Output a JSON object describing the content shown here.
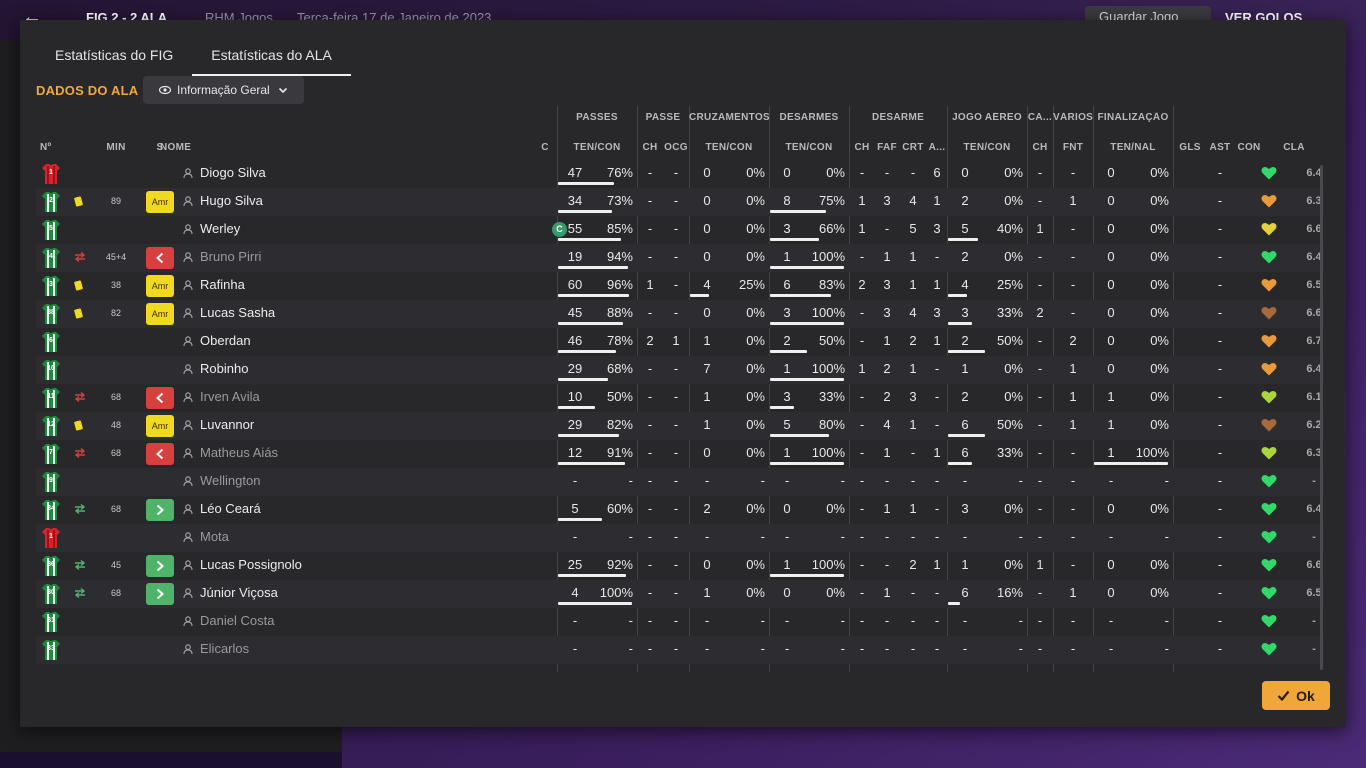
{
  "background": {
    "score": "FIG  2 - 2  ALA",
    "team": "RHM Jogos",
    "date": "Terça-feira 17 de Janeiro de 2023",
    "save_label": "Guardar Jogo",
    "goals_label": "VER GOLOS"
  },
  "tabs": [
    {
      "label": "Estatísticas do FIG",
      "active": false
    },
    {
      "label": "Estatísticas do ALA",
      "active": true
    }
  ],
  "section_title": "DADOS DO ALA",
  "view_select": {
    "value": "Informação Geral"
  },
  "groups": {
    "passes": "PASSES",
    "passe": "PASSE",
    "cruzamentos": "CRUZAMENTOS",
    "desarmes": "DESARMES",
    "desarme": "DESARME",
    "jogo_aereo": "JOGO AÉREO",
    "ca": "CA...",
    "varios": "VÁRIOS",
    "finalizacao": "FINALIZAÇÃO"
  },
  "headers": {
    "num": "Nº",
    "min": "MIN",
    "s": "S",
    "nome": "NOME",
    "c": "C",
    "passes": "TEN/CON",
    "ch1": "CH",
    "ocg": "OCG",
    "cruz": "TEN/CON",
    "des": "TEN/CON",
    "ch2": "CH",
    "faf": "FAF",
    "crt": "CRT",
    "a": "A...",
    "aereo": "TEN/CON",
    "ch3": "CH",
    "fnt": "FNT",
    "fin": "TEN/NAL",
    "gls": "GLS",
    "ast": "AST",
    "con": "CON",
    "cla": "CLA"
  },
  "players": [
    {
      "num": "1",
      "kit": "red",
      "card": "",
      "swap": "",
      "min": "",
      "status": "",
      "name": "Diogo Silva",
      "captain": "",
      "p_att": "47",
      "p_pct": "76%",
      "p_frac": 0.76,
      "ch1": "-",
      "ocg": "-",
      "cr_att": "0",
      "cr_pct": "0%",
      "cr_frac": 0,
      "d_att": "0",
      "d_pct": "0%",
      "d_frac": 0,
      "ch2": "-",
      "faf": "-",
      "crt": "-",
      "a": "6",
      "ae_att": "0",
      "ae_pct": "0%",
      "ae_frac": 0,
      "ch3": "-",
      "fnt": "-",
      "f_att": "0",
      "f_pct": "0%",
      "f_frac": 0,
      "gls": "",
      "ast": "-",
      "heart": "green",
      "rating": "6.4",
      "subbed": false
    },
    {
      "num": "2",
      "kit": "green",
      "card": "yellow",
      "swap": "",
      "min": "89",
      "status": "Amr",
      "name": "Hugo Silva",
      "captain": "",
      "p_att": "34",
      "p_pct": "73%",
      "p_frac": 0.73,
      "ch1": "-",
      "ocg": "-",
      "cr_att": "0",
      "cr_pct": "0%",
      "cr_frac": 0,
      "d_att": "8",
      "d_pct": "75%",
      "d_frac": 0.75,
      "ch2": "1",
      "faf": "3",
      "crt": "4",
      "a": "1",
      "ae_att": "2",
      "ae_pct": "0%",
      "ae_frac": 0,
      "ch3": "-",
      "fnt": "1",
      "f_att": "0",
      "f_pct": "0%",
      "f_frac": 0,
      "gls": "",
      "ast": "-",
      "heart": "orange",
      "rating": "6.3",
      "subbed": false
    },
    {
      "num": "5",
      "kit": "green",
      "card": "",
      "swap": "",
      "min": "",
      "status": "",
      "name": "Werley",
      "captain": "C",
      "p_att": "55",
      "p_pct": "85%",
      "p_frac": 0.85,
      "ch1": "-",
      "ocg": "-",
      "cr_att": "0",
      "cr_pct": "0%",
      "cr_frac": 0,
      "d_att": "3",
      "d_pct": "66%",
      "d_frac": 0.66,
      "ch2": "1",
      "faf": "-",
      "crt": "5",
      "a": "3",
      "ae_att": "5",
      "ae_pct": "40%",
      "ae_frac": 0.4,
      "ch3": "1",
      "fnt": "-",
      "f_att": "0",
      "f_pct": "0%",
      "f_frac": 0,
      "gls": "",
      "ast": "-",
      "heart": "yellow",
      "rating": "6.6",
      "subbed": false
    },
    {
      "num": "4",
      "kit": "green",
      "card": "",
      "swap": "red",
      "min": "45+4",
      "status": "out",
      "name": "Bruno Pirri",
      "captain": "",
      "p_att": "19",
      "p_pct": "94%",
      "p_frac": 0.94,
      "ch1": "-",
      "ocg": "-",
      "cr_att": "0",
      "cr_pct": "0%",
      "cr_frac": 0,
      "d_att": "1",
      "d_pct": "100%",
      "d_frac": 1,
      "ch2": "-",
      "faf": "1",
      "crt": "1",
      "a": "-",
      "ae_att": "2",
      "ae_pct": "0%",
      "ae_frac": 0,
      "ch3": "-",
      "fnt": "-",
      "f_att": "0",
      "f_pct": "0%",
      "f_frac": 0,
      "gls": "",
      "ast": "-",
      "heart": "green",
      "rating": "6.4",
      "subbed": true
    },
    {
      "num": "3",
      "kit": "green",
      "card": "yellow",
      "swap": "",
      "min": "38",
      "status": "Amr",
      "name": "Rafinha",
      "captain": "",
      "p_att": "60",
      "p_pct": "96%",
      "p_frac": 0.96,
      "ch1": "1",
      "ocg": "-",
      "cr_att": "4",
      "cr_pct": "25%",
      "cr_frac": 0.25,
      "d_att": "6",
      "d_pct": "83%",
      "d_frac": 0.83,
      "ch2": "2",
      "faf": "3",
      "crt": "1",
      "a": "1",
      "ae_att": "4",
      "ae_pct": "25%",
      "ae_frac": 0.25,
      "ch3": "-",
      "fnt": "-",
      "f_att": "0",
      "f_pct": "0%",
      "f_frac": 0,
      "gls": "",
      "ast": "-",
      "heart": "orange",
      "rating": "6.5",
      "subbed": false
    },
    {
      "num": "88",
      "kit": "green",
      "card": "yellow",
      "swap": "",
      "min": "82",
      "status": "Amr",
      "name": "Lucas Sasha",
      "captain": "",
      "p_att": "45",
      "p_pct": "88%",
      "p_frac": 0.88,
      "ch1": "-",
      "ocg": "-",
      "cr_att": "0",
      "cr_pct": "0%",
      "cr_frac": 0,
      "d_att": "3",
      "d_pct": "100%",
      "d_frac": 1,
      "ch2": "-",
      "faf": "3",
      "crt": "4",
      "a": "3",
      "ae_att": "3",
      "ae_pct": "33%",
      "ae_frac": 0.33,
      "ch3": "2",
      "fnt": "-",
      "f_att": "0",
      "f_pct": "0%",
      "f_frac": 0,
      "gls": "",
      "ast": "-",
      "heart": "brown",
      "rating": "6.6",
      "subbed": false
    },
    {
      "num": "6",
      "kit": "green",
      "card": "",
      "swap": "",
      "min": "",
      "status": "",
      "name": "Oberdan",
      "captain": "",
      "p_att": "46",
      "p_pct": "78%",
      "p_frac": 0.78,
      "ch1": "2",
      "ocg": "1",
      "cr_att": "1",
      "cr_pct": "0%",
      "cr_frac": 0,
      "d_att": "2",
      "d_pct": "50%",
      "d_frac": 0.5,
      "ch2": "-",
      "faf": "1",
      "crt": "2",
      "a": "1",
      "ae_att": "2",
      "ae_pct": "50%",
      "ae_frac": 0.5,
      "ch3": "-",
      "fnt": "2",
      "f_att": "0",
      "f_pct": "0%",
      "f_frac": 0,
      "gls": "",
      "ast": "-",
      "heart": "orange",
      "rating": "6.7",
      "subbed": false
    },
    {
      "num": "10",
      "kit": "green",
      "card": "",
      "swap": "",
      "min": "",
      "status": "",
      "name": "Robinho",
      "captain": "",
      "p_att": "29",
      "p_pct": "68%",
      "p_frac": 0.68,
      "ch1": "-",
      "ocg": "-",
      "cr_att": "7",
      "cr_pct": "0%",
      "cr_frac": 0,
      "d_att": "1",
      "d_pct": "100%",
      "d_frac": 1,
      "ch2": "1",
      "faf": "2",
      "crt": "1",
      "a": "-",
      "ae_att": "1",
      "ae_pct": "0%",
      "ae_frac": 0,
      "ch3": "-",
      "fnt": "1",
      "f_att": "0",
      "f_pct": "0%",
      "f_frac": 0,
      "gls": "",
      "ast": "-",
      "heart": "orange",
      "rating": "6.4",
      "subbed": false
    },
    {
      "num": "11",
      "kit": "green",
      "card": "",
      "swap": "red",
      "min": "68",
      "status": "out",
      "name": "Irven Avila",
      "captain": "",
      "p_att": "10",
      "p_pct": "50%",
      "p_frac": 0.5,
      "ch1": "-",
      "ocg": "-",
      "cr_att": "1",
      "cr_pct": "0%",
      "cr_frac": 0,
      "d_att": "3",
      "d_pct": "33%",
      "d_frac": 0.33,
      "ch2": "-",
      "faf": "2",
      "crt": "3",
      "a": "-",
      "ae_att": "2",
      "ae_pct": "0%",
      "ae_frac": 0,
      "ch3": "-",
      "fnt": "1",
      "f_att": "1",
      "f_pct": "0%",
      "f_frac": 0,
      "gls": "",
      "ast": "-",
      "heart": "lime",
      "rating": "6.1",
      "subbed": true
    },
    {
      "num": "12",
      "kit": "green",
      "card": "yellow",
      "swap": "",
      "min": "48",
      "status": "Amr",
      "name": "Luvannor",
      "captain": "",
      "p_att": "29",
      "p_pct": "82%",
      "p_frac": 0.82,
      "ch1": "-",
      "ocg": "-",
      "cr_att": "1",
      "cr_pct": "0%",
      "cr_frac": 0,
      "d_att": "5",
      "d_pct": "80%",
      "d_frac": 0.8,
      "ch2": "-",
      "faf": "4",
      "crt": "1",
      "a": "-",
      "ae_att": "6",
      "ae_pct": "50%",
      "ae_frac": 0.5,
      "ch3": "-",
      "fnt": "1",
      "f_att": "1",
      "f_pct": "0%",
      "f_frac": 0,
      "gls": "",
      "ast": "-",
      "heart": "brown",
      "rating": "6.2",
      "subbed": false
    },
    {
      "num": "7",
      "kit": "green",
      "card": "",
      "swap": "red",
      "min": "68",
      "status": "out",
      "name": "Matheus Aiás",
      "captain": "",
      "p_att": "12",
      "p_pct": "91%",
      "p_frac": 0.91,
      "ch1": "-",
      "ocg": "-",
      "cr_att": "0",
      "cr_pct": "0%",
      "cr_frac": 0,
      "d_att": "1",
      "d_pct": "100%",
      "d_frac": 1,
      "ch2": "-",
      "faf": "1",
      "crt": "-",
      "a": "1",
      "ae_att": "6",
      "ae_pct": "33%",
      "ae_frac": 0.33,
      "ch3": "-",
      "fnt": "-",
      "f_att": "1",
      "f_pct": "100%",
      "f_frac": 1,
      "gls": "",
      "ast": "-",
      "heart": "lime",
      "rating": "6.3",
      "subbed": true
    },
    {
      "num": "9",
      "kit": "green",
      "card": "",
      "swap": "",
      "min": "",
      "status": "",
      "name": "Wellington",
      "captain": "",
      "p_att": "-",
      "p_pct": "-",
      "p_frac": 0,
      "ch1": "-",
      "ocg": "-",
      "cr_att": "-",
      "cr_pct": "-",
      "cr_frac": 0,
      "d_att": "-",
      "d_pct": "-",
      "d_frac": 0,
      "ch2": "-",
      "faf": "-",
      "crt": "-",
      "a": "-",
      "ae_att": "-",
      "ae_pct": "-",
      "ae_frac": 0,
      "ch3": "-",
      "fnt": "-",
      "f_att": "-",
      "f_pct": "-",
      "f_frac": 0,
      "gls": "",
      "ast": "-",
      "heart": "green",
      "rating": "-",
      "subbed": true
    },
    {
      "num": "34",
      "kit": "green",
      "card": "",
      "swap": "green",
      "min": "68",
      "status": "in",
      "name": "Léo Ceará",
      "captain": "",
      "p_att": "5",
      "p_pct": "60%",
      "p_frac": 0.6,
      "ch1": "-",
      "ocg": "-",
      "cr_att": "2",
      "cr_pct": "0%",
      "cr_frac": 0,
      "d_att": "0",
      "d_pct": "0%",
      "d_frac": 0,
      "ch2": "-",
      "faf": "1",
      "crt": "1",
      "a": "-",
      "ae_att": "3",
      "ae_pct": "0%",
      "ae_frac": 0,
      "ch3": "-",
      "fnt": "-",
      "f_att": "0",
      "f_pct": "0%",
      "f_frac": 0,
      "gls": "",
      "ast": "-",
      "heart": "green",
      "rating": "6.4",
      "subbed": false
    },
    {
      "num": "1",
      "kit": "red",
      "card": "",
      "swap": "",
      "min": "",
      "status": "",
      "name": "Mota",
      "captain": "",
      "p_att": "-",
      "p_pct": "-",
      "p_frac": 0,
      "ch1": "-",
      "ocg": "-",
      "cr_att": "-",
      "cr_pct": "-",
      "cr_frac": 0,
      "d_att": "-",
      "d_pct": "-",
      "d_frac": 0,
      "ch2": "-",
      "faf": "-",
      "crt": "-",
      "a": "-",
      "ae_att": "-",
      "ae_pct": "-",
      "ae_frac": 0,
      "ch3": "-",
      "fnt": "-",
      "f_att": "-",
      "f_pct": "-",
      "f_frac": 0,
      "gls": "",
      "ast": "-",
      "heart": "green",
      "rating": "-",
      "subbed": true
    },
    {
      "num": "36",
      "kit": "green",
      "card": "",
      "swap": "green",
      "min": "45",
      "status": "in",
      "name": "Lucas Possignolo",
      "captain": "",
      "p_att": "25",
      "p_pct": "92%",
      "p_frac": 0.92,
      "ch1": "-",
      "ocg": "-",
      "cr_att": "0",
      "cr_pct": "0%",
      "cr_frac": 0,
      "d_att": "1",
      "d_pct": "100%",
      "d_frac": 1,
      "ch2": "-",
      "faf": "-",
      "crt": "2",
      "a": "1",
      "ae_att": "1",
      "ae_pct": "0%",
      "ae_frac": 0,
      "ch3": "1",
      "fnt": "-",
      "f_att": "0",
      "f_pct": "0%",
      "f_frac": 0,
      "gls": "",
      "ast": "-",
      "heart": "green",
      "rating": "6.6",
      "subbed": false
    },
    {
      "num": "30",
      "kit": "green",
      "card": "",
      "swap": "green",
      "min": "68",
      "status": "in",
      "name": "Júnior Viçosa",
      "captain": "",
      "p_att": "4",
      "p_pct": "100%",
      "p_frac": 1,
      "ch1": "-",
      "ocg": "-",
      "cr_att": "1",
      "cr_pct": "0%",
      "cr_frac": 0,
      "d_att": "0",
      "d_pct": "0%",
      "d_frac": 0,
      "ch2": "-",
      "faf": "1",
      "crt": "-",
      "a": "-",
      "ae_att": "6",
      "ae_pct": "16%",
      "ae_frac": 0.16,
      "ch3": "-",
      "fnt": "1",
      "f_att": "0",
      "f_pct": "0%",
      "f_frac": 0,
      "gls": "",
      "ast": "-",
      "heart": "green",
      "rating": "6.5",
      "subbed": false
    },
    {
      "num": "31",
      "kit": "green",
      "card": "",
      "swap": "",
      "min": "",
      "status": "",
      "name": "Daniel Costa",
      "captain": "",
      "p_att": "-",
      "p_pct": "-",
      "p_frac": 0,
      "ch1": "-",
      "ocg": "-",
      "cr_att": "-",
      "cr_pct": "-",
      "cr_frac": 0,
      "d_att": "-",
      "d_pct": "-",
      "d_frac": 0,
      "ch2": "-",
      "faf": "-",
      "crt": "-",
      "a": "-",
      "ae_att": "-",
      "ae_pct": "-",
      "ae_frac": 0,
      "ch3": "-",
      "fnt": "-",
      "f_att": "-",
      "f_pct": "-",
      "f_frac": 0,
      "gls": "",
      "ast": "-",
      "heart": "green",
      "rating": "-",
      "subbed": true
    },
    {
      "num": "33",
      "kit": "green",
      "card": "",
      "swap": "",
      "min": "",
      "status": "",
      "name": "Elicarlos",
      "captain": "",
      "p_att": "-",
      "p_pct": "-",
      "p_frac": 0,
      "ch1": "-",
      "ocg": "-",
      "cr_att": "-",
      "cr_pct": "-",
      "cr_frac": 0,
      "d_att": "-",
      "d_pct": "-",
      "d_frac": 0,
      "ch2": "-",
      "faf": "-",
      "crt": "-",
      "a": "-",
      "ae_att": "-",
      "ae_pct": "-",
      "ae_frac": 0,
      "ch3": "-",
      "fnt": "-",
      "f_att": "-",
      "f_pct": "-",
      "f_frac": 0,
      "gls": "",
      "ast": "-",
      "heart": "green",
      "rating": "-",
      "subbed": true
    }
  ],
  "colors": {
    "accent": "#f2a93b",
    "yellow_card": "#f1d91f",
    "sub_out": "#d83f3f",
    "sub_in": "#4fb46a",
    "heart_green": "#33d86a",
    "heart_orange": "#e89a3c",
    "heart_yellow": "#e3d03a",
    "heart_lime": "#a9d63a",
    "heart_brown": "#a66a3c"
  },
  "ok_label": "Ok"
}
